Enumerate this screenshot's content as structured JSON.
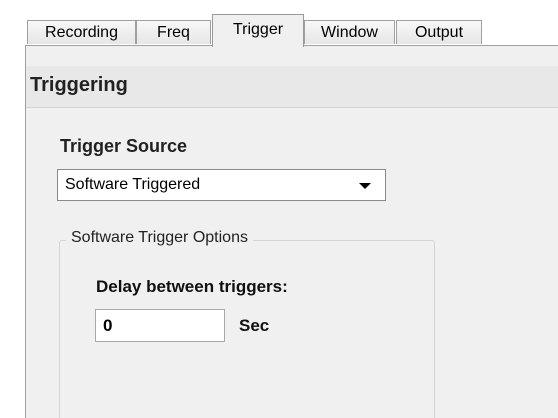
{
  "tabs": [
    {
      "label": "Recording",
      "selected": false
    },
    {
      "label": "Freq",
      "selected": false
    },
    {
      "label": "Trigger",
      "selected": true
    },
    {
      "label": "Window",
      "selected": false
    },
    {
      "label": "Output",
      "selected": false
    }
  ],
  "panel": {
    "title": "Triggering"
  },
  "trigger_source": {
    "label": "Trigger Source",
    "selected_value": "Software Triggered"
  },
  "software_options": {
    "group_title": "Software Trigger Options",
    "delay_label": "Delay between triggers:",
    "delay_value": "0",
    "delay_unit": "Sec"
  }
}
